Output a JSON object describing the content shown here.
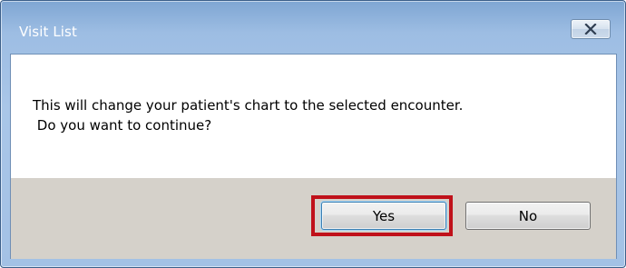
{
  "window": {
    "title": "Visit List",
    "close_icon": "close-icon"
  },
  "message": {
    "line1": "This will change your patient's chart to the selected encounter.",
    "line2": " Do you want to continue?"
  },
  "buttons": {
    "yes_label": "Yes",
    "no_label": "No"
  },
  "colors": {
    "title_bar": "#a9c6e8",
    "button_area": "#d5d1ca",
    "highlight": "#c0111a"
  }
}
